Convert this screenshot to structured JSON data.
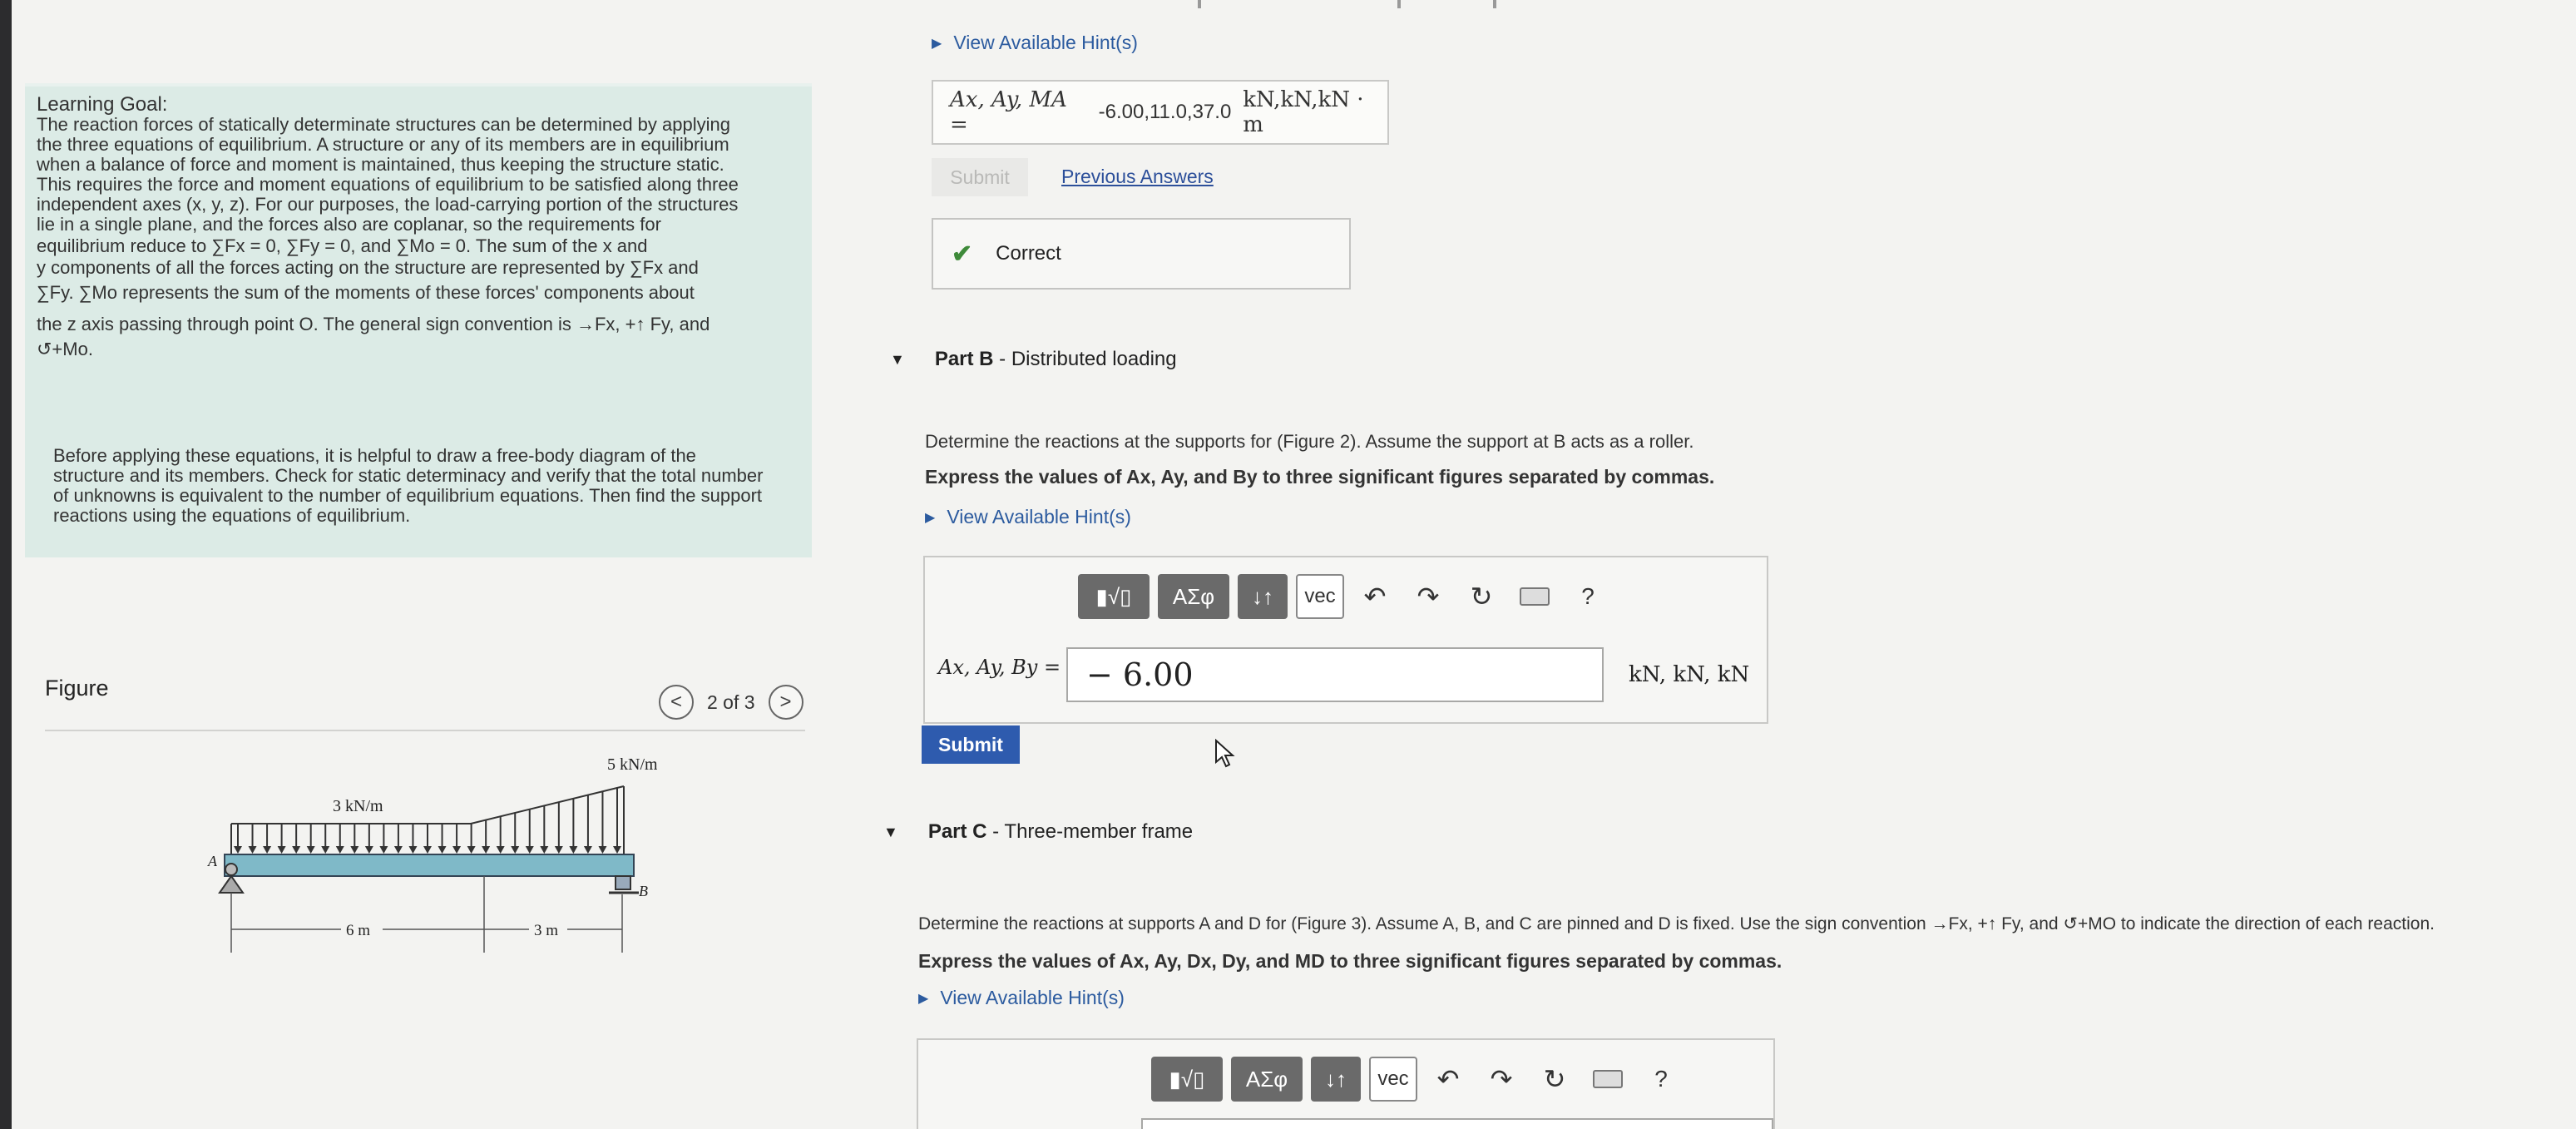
{
  "learning_goal": {
    "title": "Learning Goal:",
    "paragraph1_lines": [
      "The reaction forces of statically determinate structures can be determined by applying",
      "the three equations of equilibrium. A structure or any of its members are in equilibrium",
      "when a balance of force and moment is maintained, thus keeping the structure static.",
      "This requires the force and moment equations of equilibrium to be satisfied along three",
      "independent axes (x, y, z). For our purposes, the load-carrying portion of the structures",
      "lie in a single plane, and the forces also are coplanar, so the requirements for",
      "equilibrium reduce to ∑Fx = 0, ∑Fy = 0, and ∑Mo = 0. The sum of the x and",
      "y components of all the forces acting on the structure are represented by ∑Fx and",
      "∑Fy. ∑Mo represents the sum of the moments of these forces' components about",
      "the z axis passing through point O. The general sign convention is →Fx, +↑ Fy, and",
      "↺+Mo."
    ],
    "paragraph2_lines": [
      "Before applying these equations, it is helpful to draw a free-body diagram of the",
      "structure and its members. Check for static determinacy and verify that the total number",
      "of unknowns is equivalent to the number of equilibrium equations. Then find the support",
      "reactions using the equations of equilibrium."
    ]
  },
  "figure": {
    "title": "Figure",
    "pager": "2 of 3",
    "prev_icon": "<",
    "next_icon": ">",
    "load_left": "3 kN/m",
    "load_right": "5 kN/m",
    "point_a": "A",
    "point_b": "B",
    "dim_left": "6 m",
    "dim_right": "3 m"
  },
  "part_a": {
    "hint_label": "View Available Hint(s)",
    "answer_label": "Ax, Ay, MA = ",
    "answer_value": "-6.00,11.0,37.0",
    "answer_units": "kN,kN,kN · m",
    "submit_label": "Submit",
    "previous_answers_label": "Previous Answers",
    "correct_label": "Correct"
  },
  "part_b": {
    "header_bold": "Part B",
    "header_rest": " - Distributed loading",
    "prompt": "Determine the reactions at the supports for (Figure 2). Assume the support at B acts as a roller.",
    "instruction": "Express the values of Ax, Ay, and By to three significant figures separated by commas.",
    "hint_label": "View Available Hint(s)",
    "toolbar": {
      "templates": "▮√▯",
      "greek": "ΑΣφ",
      "arrows": "↓↑",
      "vec": "vec",
      "help": "?"
    },
    "input_label": "Ax, Ay, By =",
    "input_value": "− 6.00",
    "units": "kN, kN, kN",
    "submit_label": "Submit"
  },
  "part_c": {
    "header_bold": "Part C",
    "header_rest": " - Three-member frame",
    "prompt": "Determine the reactions at supports A and D for (Figure 3). Assume A, B, and C are pinned and D is fixed. Use the sign convention →Fx, +↑ Fy, and ↺+MO to indicate the direction of each reaction.",
    "instruction": "Express the values of Ax, Ay, Dx, Dy, and MD to three significant figures separated by commas.",
    "hint_label": "View Available Hint(s)",
    "toolbar": {
      "templates": "▮√▯",
      "greek": "ΑΣφ",
      "arrows": "↓↑",
      "vec": "vec",
      "help": "?"
    }
  },
  "colors": {
    "goal_background": "#dcebe6",
    "link": "#2c5b9f",
    "submit": "#2e5bae",
    "correct_check": "#3e8a39"
  }
}
